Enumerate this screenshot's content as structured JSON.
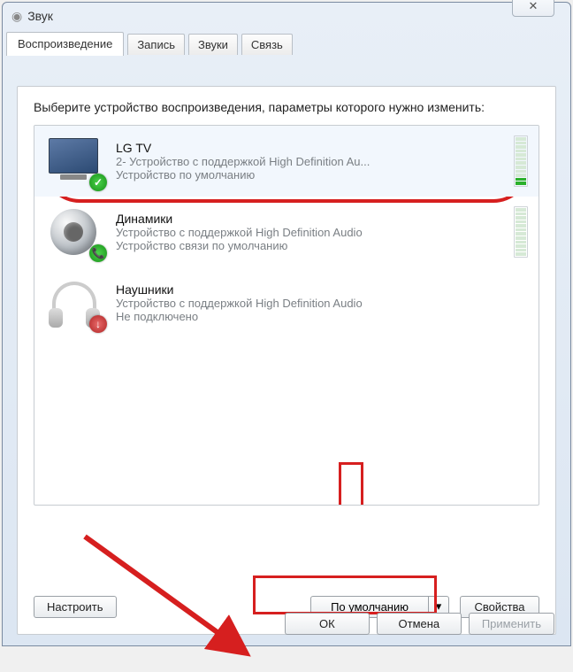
{
  "window": {
    "title": "Звук"
  },
  "tabs": {
    "playback": "Воспроизведение",
    "recording": "Запись",
    "sounds": "Звуки",
    "comm": "Связь"
  },
  "instruction": "Выберите устройство воспроизведения, параметры которого нужно изменить:",
  "devices": [
    {
      "name": "LG TV",
      "desc": "2- Устройство с поддержкой High Definition Au...",
      "status": "Устройство по умолчанию"
    },
    {
      "name": "Динамики",
      "desc": "Устройство с поддержкой High Definition Audio",
      "status": "Устройство связи по умолчанию"
    },
    {
      "name": "Наушники",
      "desc": "Устройство с поддержкой High Definition Audio",
      "status": "Не подключено"
    }
  ],
  "buttons": {
    "configure": "Настроить",
    "set_default": "По умолчанию",
    "properties": "Свойства",
    "ok": "ОК",
    "cancel": "Отмена",
    "apply": "Применить"
  }
}
